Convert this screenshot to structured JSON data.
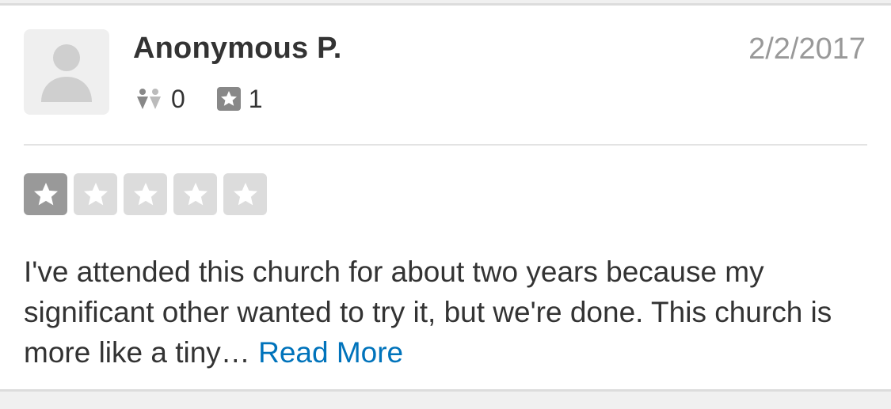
{
  "review": {
    "author": "Anonymous P.",
    "date": "2/2/2017",
    "friends_count": "0",
    "reviews_count": "1",
    "rating": 1,
    "max_rating": 5,
    "text": "I've attended this church for about two years because my significant other wanted to try it, but we're done. This church is more like a tiny…",
    "read_more_label": "Read More"
  },
  "icons": {
    "avatar": "user-silhouette-icon",
    "friends": "friends-icon",
    "reviews": "review-star-icon",
    "rating_star": "star-icon"
  },
  "colors": {
    "star_filled": "#999999",
    "star_empty": "#dcdcdc",
    "link": "#0073bb",
    "date": "#999999"
  }
}
